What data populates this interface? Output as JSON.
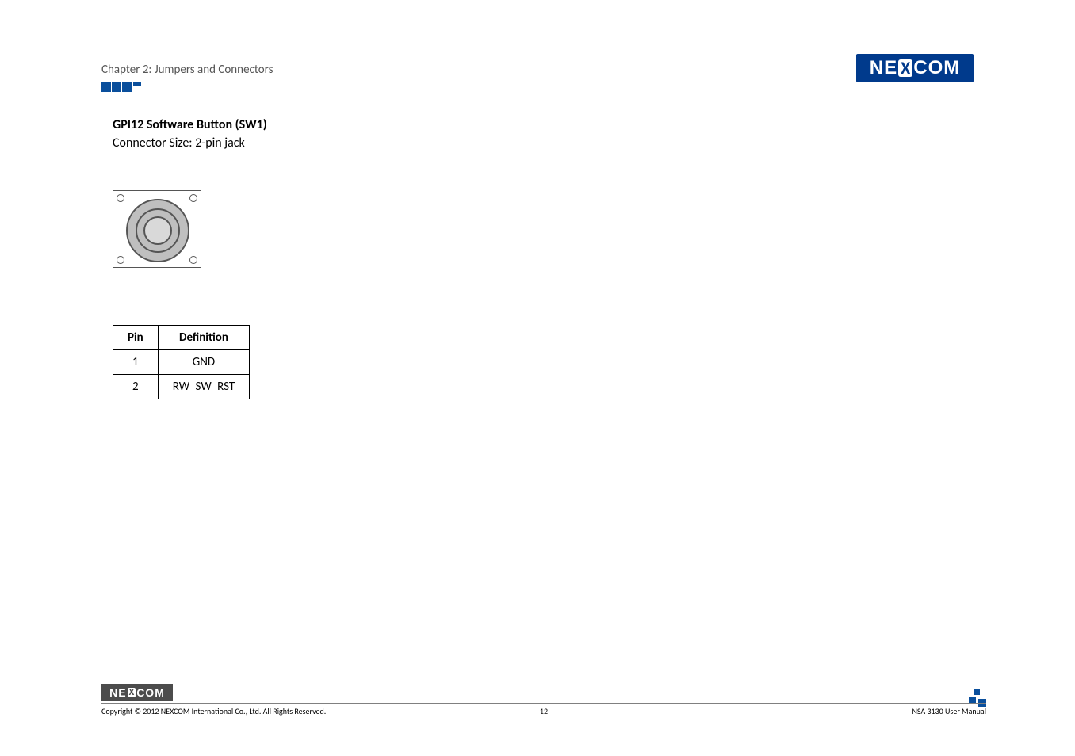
{
  "header": {
    "chapter_label": "Chapter 2: Jumpers and Connectors",
    "logo_text_left": "NE",
    "logo_text_x": "X",
    "logo_text_right": "COM"
  },
  "content": {
    "title": "GPI12 Software Button (SW1)",
    "subtitle": "Connector Size: 2-pin jack"
  },
  "table": {
    "headers": {
      "pin": "Pin",
      "definition": "Definition"
    },
    "rows": [
      {
        "pin": "1",
        "definition": "GND"
      },
      {
        "pin": "2",
        "definition": "RW_SW_RST"
      }
    ]
  },
  "footer": {
    "logo_text_left": "NE",
    "logo_text_x": "X",
    "logo_text_right": "COM",
    "copyright": "Copyright © 2012 NEXCOM International Co., Ltd. All Rights Reserved.",
    "page_number": "12",
    "manual_name": "NSA 3130 User Manual"
  }
}
